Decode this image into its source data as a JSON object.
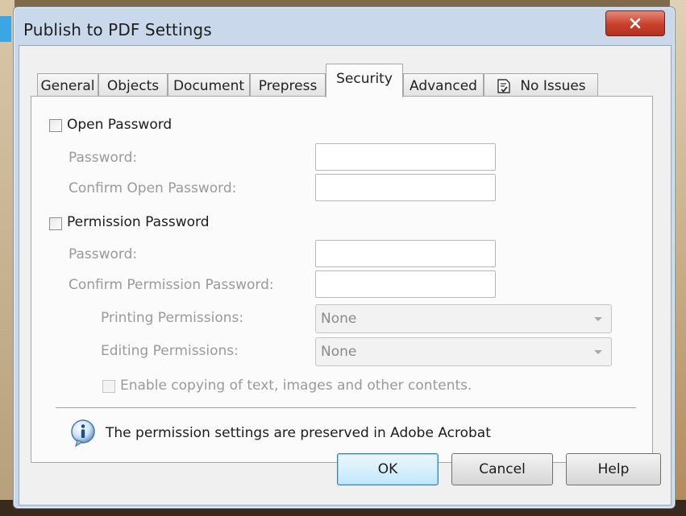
{
  "window": {
    "title": "Publish to PDF Settings",
    "close_icon": "close-icon"
  },
  "tabs": [
    {
      "label": "General",
      "active": false
    },
    {
      "label": "Objects",
      "active": false
    },
    {
      "label": "Document",
      "active": false
    },
    {
      "label": "Prepress",
      "active": false
    },
    {
      "label": "Security",
      "active": true
    },
    {
      "label": "Advanced",
      "active": false
    },
    {
      "label": "No Issues",
      "active": false,
      "icon": "preflight-icon"
    }
  ],
  "security": {
    "open_password": {
      "checkbox_label": "Open Password",
      "checked": false,
      "password_label": "Password:",
      "password_value": "",
      "confirm_label": "Confirm Open Password:",
      "confirm_value": ""
    },
    "permission_password": {
      "checkbox_label": "Permission Password",
      "checked": false,
      "password_label": "Password:",
      "password_value": "",
      "confirm_label": "Confirm Permission Password:",
      "confirm_value": "",
      "printing_label": "Printing Permissions:",
      "printing_value": "None",
      "editing_label": "Editing Permissions:",
      "editing_value": "None",
      "copy_label": "Enable copying of text, images and other contents.",
      "copy_checked": false
    },
    "info_text": "The permission settings are preserved in Adobe Acrobat",
    "info_icon": "info-icon"
  },
  "buttons": {
    "ok": "OK",
    "cancel": "Cancel",
    "help": "Help"
  },
  "colors": {
    "title_bar": "#c9d8ea",
    "close_button": "#c8402b",
    "default_button_border": "#3c7fb1"
  }
}
